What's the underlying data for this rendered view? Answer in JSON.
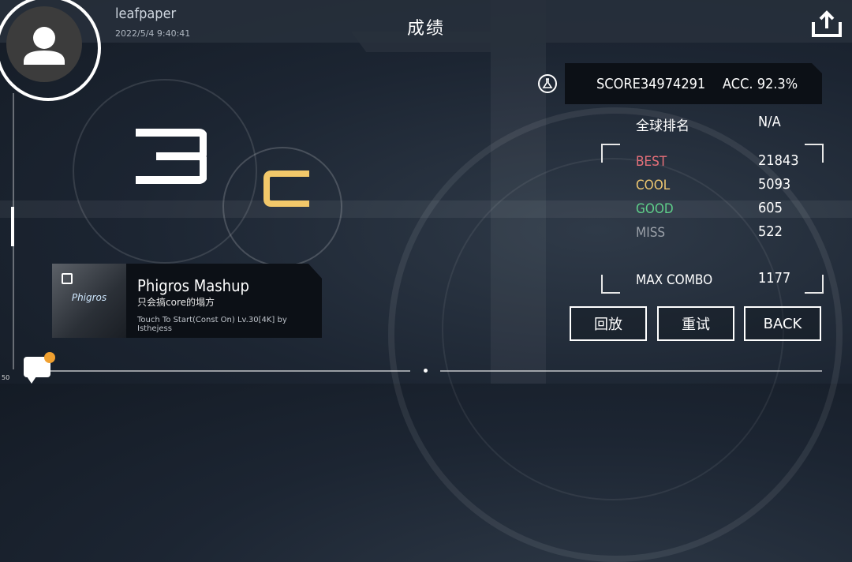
{
  "header": {
    "username": "leafpaper",
    "timestamp": "2022/5/4 9:40:41",
    "title": "成绩",
    "share_icon": "share-upload-icon"
  },
  "result": {
    "rank_number": "3",
    "grade": "C",
    "grade_color": "#f2c86a"
  },
  "song": {
    "thumbnail_text": "Phigros",
    "title": "Phigros Mashup",
    "subtitle": "只会搞core的塌方",
    "chart_info": "Touch To Start(Const On) Lv.30[4K] by Isthejess"
  },
  "score": {
    "score_label": "SCORE",
    "score_value": "34974291",
    "acc_label": "ACC.",
    "acc_value": "92.3%"
  },
  "stats": {
    "global_rank_label": "全球排名",
    "global_rank_value": "N/A",
    "best_label": "BEST",
    "best_value": "21843",
    "best_color": "#e8707a",
    "cool_label": "COOL",
    "cool_value": "5093",
    "cool_color": "#f0c870",
    "good_label": "GOOD",
    "good_value": "605",
    "good_color": "#5fd08a",
    "miss_label": "MISS",
    "miss_value": "522",
    "miss_color": "#9aa0a8",
    "max_combo_label": "MAX COMBO",
    "max_combo_value": "1177"
  },
  "actions": {
    "replay_label": "回放",
    "retry_label": "重试",
    "back_label": "BACK"
  },
  "footer": {
    "fps": "50",
    "chat_icon": "chat-bubble-icon",
    "notification_color": "#f0a030"
  }
}
